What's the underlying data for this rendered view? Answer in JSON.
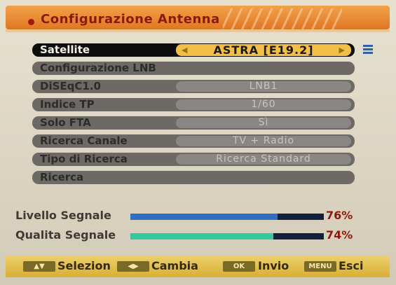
{
  "header": {
    "title": "Configurazione Antenna"
  },
  "menu": {
    "rows": [
      {
        "label": "Satellite",
        "value": "ASTRA [E19.2]",
        "selected": true
      },
      {
        "label": "Configurazione LNB",
        "value": ""
      },
      {
        "label": "DiSEqC1.0",
        "value": "LNB1"
      },
      {
        "label": "Indice TP",
        "value": "1/60"
      },
      {
        "label": "Solo FTA",
        "value": "Sì"
      },
      {
        "label": "Ricerca Canale",
        "value": "TV + Radio"
      },
      {
        "label": "Tipo di Ricerca",
        "value": "Ricerca Standard"
      },
      {
        "label": "Ricerca",
        "value": ""
      }
    ]
  },
  "signal": {
    "level": {
      "label": "Livello Segnale",
      "percent_text": "76%",
      "fraction": 0.76,
      "color": "#2e6fc4"
    },
    "quality": {
      "label": "Qualita Segnale",
      "percent_text": "74%",
      "fraction": 0.74,
      "color": "#33c8a0"
    }
  },
  "footer": {
    "select": {
      "key": "▲▼",
      "label": "Selezion"
    },
    "change": {
      "key": "◀▶",
      "label": "Cambia"
    },
    "ok": {
      "key": "OK",
      "label": "Invio"
    },
    "menu": {
      "key": "MENU",
      "label": "Esci"
    }
  },
  "colors": {
    "header": "#e58a35",
    "selected_value": "#f4bf46",
    "footer": "#e0bc4a"
  }
}
